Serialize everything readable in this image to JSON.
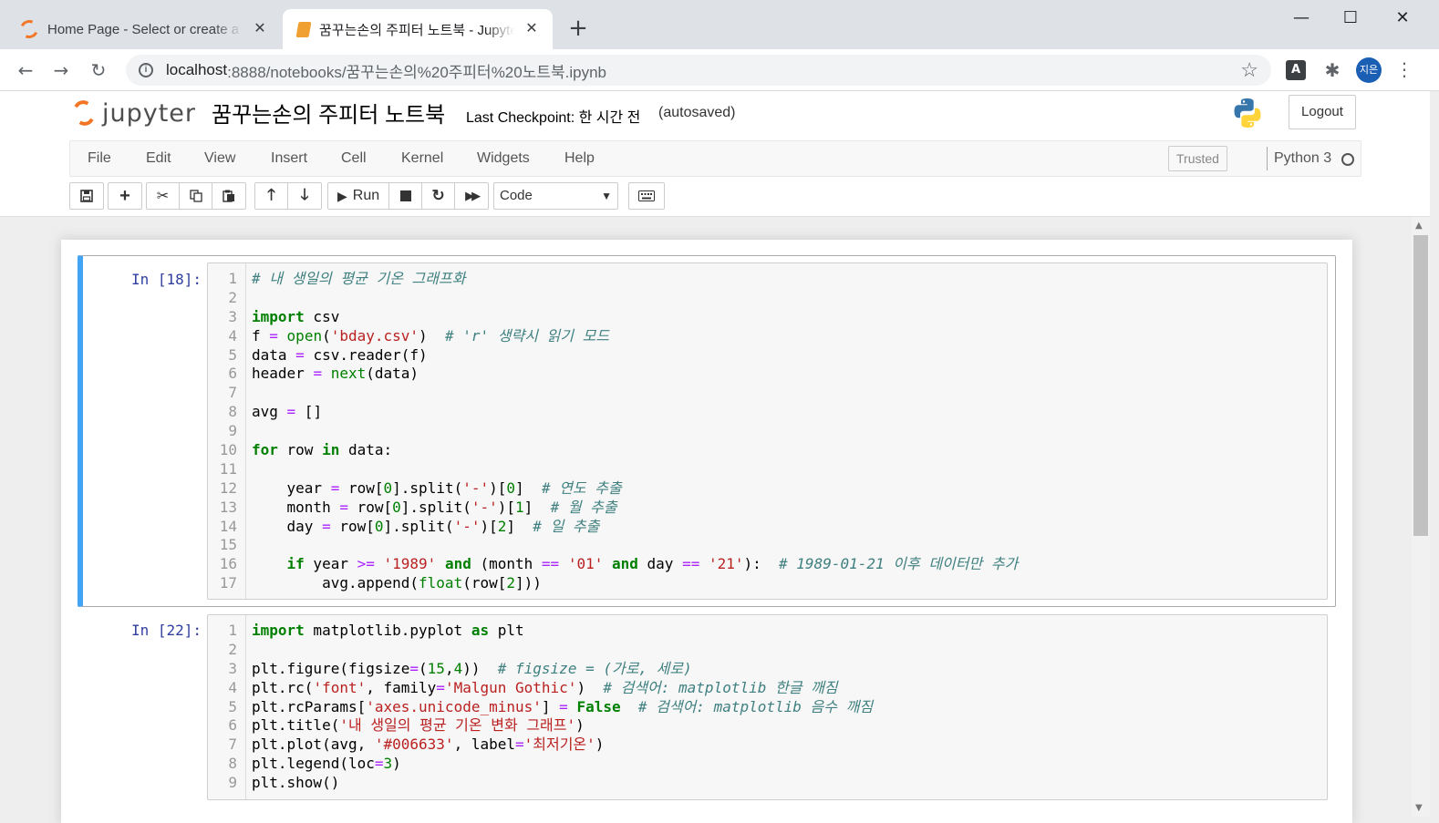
{
  "browser": {
    "tabs": [
      {
        "title": "Home Page - Select or create a notebook",
        "favicon": "jupyter-icon"
      },
      {
        "title": "꿈꾸는손의 주피터 노트북 - Jupyter Notebook",
        "favicon": "notebook-icon"
      }
    ],
    "new_tab": "+",
    "url_host": "localhost",
    "url_path": ":8888/notebooks/꿈꾸는손의%20주피터%20노트북.ipynb",
    "profile_initials": "지은"
  },
  "jupyter": {
    "logo_text": "jupyter",
    "notebook_name": "꿈꾸는손의 주피터 노트북",
    "checkpoint": "Last Checkpoint: 한 시간 전",
    "autosaved": "(autosaved)",
    "logout": "Logout",
    "menu": [
      "File",
      "Edit",
      "View",
      "Insert",
      "Cell",
      "Kernel",
      "Widgets",
      "Help"
    ],
    "trusted": "Trusted",
    "kernel": "Python 3",
    "run_label": "Run",
    "cell_type": "Code"
  },
  "cells": [
    {
      "prompt": "In [18]:",
      "lines": [
        [
          [
            "cm",
            "# 내 생일의 평균 기온 그래프화"
          ]
        ],
        [],
        [
          [
            "kw",
            "import"
          ],
          [
            "p",
            " csv"
          ]
        ],
        [
          [
            "p",
            "f "
          ],
          [
            "op",
            "="
          ],
          [
            "p",
            " "
          ],
          [
            "bi",
            "open"
          ],
          [
            "p",
            "("
          ],
          [
            "str",
            "'bday.csv'"
          ],
          [
            "p",
            ")  "
          ],
          [
            "cm",
            "# 'r' 생략시 읽기 모드"
          ]
        ],
        [
          [
            "p",
            "data "
          ],
          [
            "op",
            "="
          ],
          [
            "p",
            " csv.reader(f)"
          ]
        ],
        [
          [
            "p",
            "header "
          ],
          [
            "op",
            "="
          ],
          [
            "p",
            " "
          ],
          [
            "bi",
            "next"
          ],
          [
            "p",
            "(data)"
          ]
        ],
        [],
        [
          [
            "p",
            "avg "
          ],
          [
            "op",
            "="
          ],
          [
            "p",
            " []"
          ]
        ],
        [],
        [
          [
            "kw",
            "for"
          ],
          [
            "p",
            " row "
          ],
          [
            "kw",
            "in"
          ],
          [
            "p",
            " data:"
          ]
        ],
        [],
        [
          [
            "p",
            "    year "
          ],
          [
            "op",
            "="
          ],
          [
            "p",
            " row["
          ],
          [
            "num",
            "0"
          ],
          [
            "p",
            "].split("
          ],
          [
            "str",
            "'-'"
          ],
          [
            "p",
            ")["
          ],
          [
            "num",
            "0"
          ],
          [
            "p",
            "]  "
          ],
          [
            "cm",
            "# 연도 추출"
          ]
        ],
        [
          [
            "p",
            "    month "
          ],
          [
            "op",
            "="
          ],
          [
            "p",
            " row["
          ],
          [
            "num",
            "0"
          ],
          [
            "p",
            "].split("
          ],
          [
            "str",
            "'-'"
          ],
          [
            "p",
            ")["
          ],
          [
            "num",
            "1"
          ],
          [
            "p",
            "]  "
          ],
          [
            "cm",
            "# 월 추출"
          ]
        ],
        [
          [
            "p",
            "    day "
          ],
          [
            "op",
            "="
          ],
          [
            "p",
            " row["
          ],
          [
            "num",
            "0"
          ],
          [
            "p",
            "].split("
          ],
          [
            "str",
            "'-'"
          ],
          [
            "p",
            ")["
          ],
          [
            "num",
            "2"
          ],
          [
            "p",
            "]  "
          ],
          [
            "cm",
            "# 일 추출"
          ]
        ],
        [],
        [
          [
            "p",
            "    "
          ],
          [
            "kw",
            "if"
          ],
          [
            "p",
            " year "
          ],
          [
            "op",
            ">="
          ],
          [
            "p",
            " "
          ],
          [
            "str",
            "'1989'"
          ],
          [
            "p",
            " "
          ],
          [
            "kw",
            "and"
          ],
          [
            "p",
            " (month "
          ],
          [
            "op",
            "=="
          ],
          [
            "p",
            " "
          ],
          [
            "str",
            "'01'"
          ],
          [
            "p",
            " "
          ],
          [
            "kw",
            "and"
          ],
          [
            "p",
            " day "
          ],
          [
            "op",
            "=="
          ],
          [
            "p",
            " "
          ],
          [
            "str",
            "'21'"
          ],
          [
            "p",
            "):  "
          ],
          [
            "cm",
            "# 1989-01-21 이후 데이터만 추가"
          ]
        ],
        [
          [
            "p",
            "        avg.append("
          ],
          [
            "bi",
            "float"
          ],
          [
            "p",
            "(row["
          ],
          [
            "num",
            "2"
          ],
          [
            "p",
            "]))"
          ]
        ]
      ]
    },
    {
      "prompt": "In [22]:",
      "lines": [
        [
          [
            "kw",
            "import"
          ],
          [
            "p",
            " matplotlib.pyplot "
          ],
          [
            "kw",
            "as"
          ],
          [
            "p",
            " plt"
          ]
        ],
        [],
        [
          [
            "p",
            "plt.figure(figsize"
          ],
          [
            "op",
            "="
          ],
          [
            "p",
            "("
          ],
          [
            "num",
            "15"
          ],
          [
            "p",
            ","
          ],
          [
            "num",
            "4"
          ],
          [
            "p",
            "))  "
          ],
          [
            "cm",
            "# figsize = (가로, 세로)"
          ]
        ],
        [
          [
            "p",
            "plt.rc("
          ],
          [
            "str",
            "'font'"
          ],
          [
            "p",
            ", family"
          ],
          [
            "op",
            "="
          ],
          [
            "str",
            "'Malgun Gothic'"
          ],
          [
            "p",
            ")  "
          ],
          [
            "cm",
            "# 검색어: matplotlib 한글 깨짐"
          ]
        ],
        [
          [
            "p",
            "plt.rcParams["
          ],
          [
            "str",
            "'axes.unicode_minus'"
          ],
          [
            "p",
            "] "
          ],
          [
            "op",
            "="
          ],
          [
            "p",
            " "
          ],
          [
            "kw",
            "False"
          ],
          [
            "p",
            "  "
          ],
          [
            "cm",
            "# 검색어: matplotlib 음수 깨짐"
          ]
        ],
        [
          [
            "p",
            "plt.title("
          ],
          [
            "str",
            "'내 생일의 평균 기온 변화 그래프'"
          ],
          [
            "p",
            ")"
          ]
        ],
        [
          [
            "p",
            "plt.plot(avg, "
          ],
          [
            "str",
            "'#006633'"
          ],
          [
            "p",
            ", label"
          ],
          [
            "op",
            "="
          ],
          [
            "str",
            "'최저기온'"
          ],
          [
            "p",
            ")"
          ]
        ],
        [
          [
            "p",
            "plt.legend(loc"
          ],
          [
            "op",
            "="
          ],
          [
            "num",
            "3"
          ],
          [
            "p",
            ")"
          ]
        ],
        [
          [
            "p",
            "plt.show()"
          ]
        ]
      ]
    }
  ]
}
